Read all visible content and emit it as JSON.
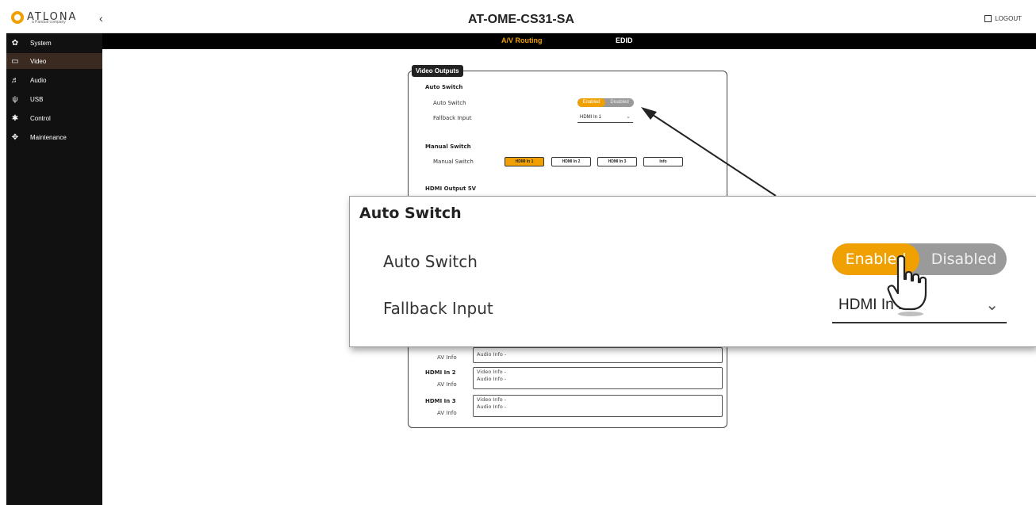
{
  "header": {
    "logo_text": "ATLONA",
    "logo_sub": "a Panduit company",
    "collapse_glyph": "‹",
    "device_name": "AT-OME-CS31-SA",
    "logout_label": "LOGOUT"
  },
  "tabs": [
    {
      "label": "A/V Routing",
      "active": true
    },
    {
      "label": "EDID",
      "active": false
    }
  ],
  "sidebar": {
    "items": [
      {
        "label": "System",
        "icon": "gear-icon",
        "glyph": "✿"
      },
      {
        "label": "Video",
        "icon": "monitor-icon",
        "glyph": "▭",
        "active": true
      },
      {
        "label": "Audio",
        "icon": "audio-icon",
        "glyph": "♬"
      },
      {
        "label": "USB",
        "icon": "usb-icon",
        "glyph": "ψ"
      },
      {
        "label": "Control",
        "icon": "control-icon",
        "glyph": "✱"
      },
      {
        "label": "Maintenance",
        "icon": "maintenance-icon",
        "glyph": "✥"
      }
    ]
  },
  "video_outputs": {
    "legend": "Video Outputs",
    "auto_switch": {
      "section_title": "Auto Switch",
      "auto_switch_label": "Auto Switch",
      "enabled_label": "Enabled",
      "disabled_label": "Disabled",
      "fallback_label": "Fallback Input",
      "fallback_value": "HDMI In 1"
    },
    "manual_switch": {
      "section_title": "Manual Switch",
      "row_label": "Manual Switch",
      "buttons": [
        "HDMI In 1",
        "HDMI In 2",
        "HDMI In 3",
        "Info"
      ],
      "selected": "HDMI In 1"
    },
    "hdmi_output_5v": {
      "section_title": "HDMI Output 5V"
    },
    "info_rows": [
      {
        "name": "",
        "sub": "AV Info",
        "video": "",
        "audio": "Audio Info -"
      },
      {
        "name": "HDMI In 2",
        "sub": "AV Info",
        "video": "Video Info -",
        "audio": "Audio Info -"
      },
      {
        "name": "HDMI In 3",
        "sub": "AV Info",
        "video": "Video Info -",
        "audio": "Audio Info -"
      }
    ]
  },
  "zoom": {
    "section_title": "Auto Switch",
    "auto_switch_label": "Auto Switch",
    "enabled_label": "Enabled",
    "disabled_label": "Disabled",
    "fallback_label": "Fallback Input",
    "fallback_value": "HDMI In 1"
  },
  "colors": {
    "accent": "#f0a000",
    "sidebar_bg": "#111111",
    "sidebar_active": "#3a2a20",
    "tabbar_bg": "#000000"
  }
}
